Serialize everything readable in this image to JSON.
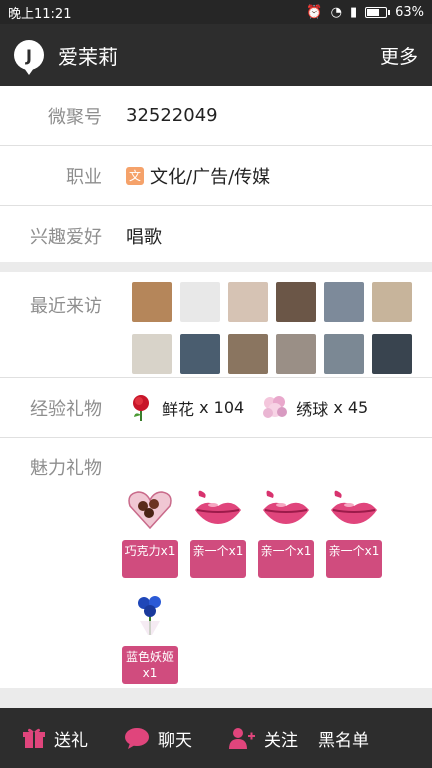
{
  "status": {
    "time": "晚上11:21",
    "battery": "63%"
  },
  "header": {
    "title": "爱茉莉",
    "more": "更多"
  },
  "profile": {
    "id_label": "微聚号",
    "id_value": "32522049",
    "job_label": "职业",
    "job_icon_text": "文",
    "job_value": "文化/广告/传媒",
    "hobby_label": "兴趣爱好",
    "hobby_value": "唱歌"
  },
  "visits": {
    "label": "最近来访",
    "thumb_colors": [
      "#b5865a",
      "#e8e8e8",
      "#d6c3b4",
      "#6b5647",
      "#7d8a9a",
      "#c7b49b",
      "#d8d3c9",
      "#4a5d6f",
      "#8a7560",
      "#9a8f86",
      "#7b8894",
      "#39444f"
    ]
  },
  "exp_gifts": {
    "label": "经验礼物",
    "items": [
      {
        "name": "鲜花",
        "count": "x 104",
        "icon": "rose-icon"
      },
      {
        "name": "绣球",
        "count": "x 45",
        "icon": "hydrangea-icon"
      }
    ]
  },
  "charm_gifts": {
    "label": "魅力礼物",
    "items": [
      {
        "label": "巧克力x1",
        "icon": "chocolate-icon"
      },
      {
        "label": "亲一个x1",
        "icon": "lips-icon"
      },
      {
        "label": "亲一个x1",
        "icon": "lips-icon"
      },
      {
        "label": "亲一个x1",
        "icon": "lips-icon"
      },
      {
        "label": "蓝色妖姬x1",
        "icon": "blue-rose-icon"
      }
    ]
  },
  "bottom": {
    "gift": "送礼",
    "chat": "聊天",
    "follow": "关注",
    "block": "黑名单"
  }
}
